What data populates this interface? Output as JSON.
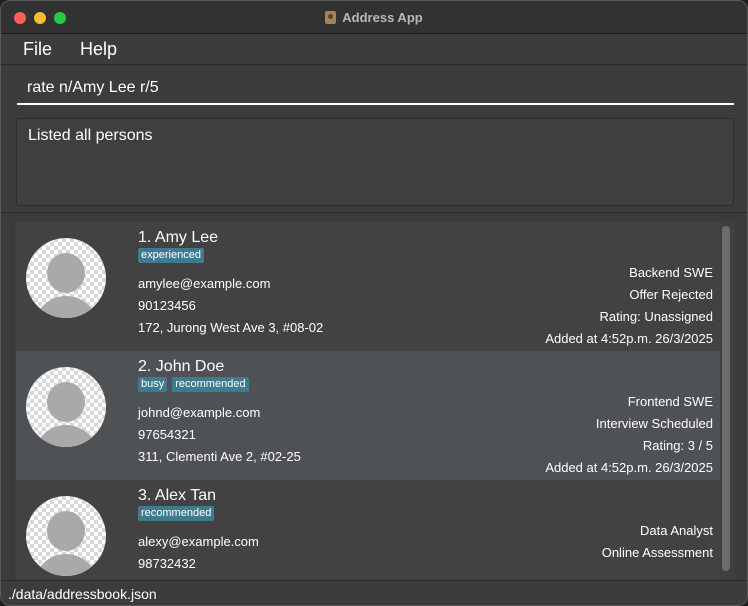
{
  "window": {
    "title": "Address App"
  },
  "menu": {
    "items": [
      "File",
      "Help"
    ]
  },
  "command": {
    "value": "rate n/Amy Lee r/5"
  },
  "result": {
    "text": "Listed all persons"
  },
  "persons": [
    {
      "name": "1. Amy Lee",
      "tags": [
        "experienced"
      ],
      "email": "amylee@example.com",
      "phone": "90123456",
      "address": "172, Jurong West Ave 3, #08-02",
      "role": "Backend SWE",
      "status": "Offer Rejected",
      "rating": "Rating: Unassigned",
      "added": "Added at 4:52p.m. 26/3/2025"
    },
    {
      "name": "2. John Doe",
      "tags": [
        "busy",
        "recommended"
      ],
      "email": "johnd@example.com",
      "phone": "97654321",
      "address": "311, Clementi Ave 2, #02-25",
      "role": "Frontend SWE",
      "status": "Interview Scheduled",
      "rating": "Rating: 3 / 5",
      "added": "Added at 4:52p.m. 26/3/2025"
    },
    {
      "name": "3. Alex Tan",
      "tags": [
        "recommended"
      ],
      "email": "alexy@example.com",
      "phone": "98732432",
      "address": "",
      "role": "Data Analyst",
      "status": "Online Assessment",
      "rating": "",
      "added": ""
    }
  ],
  "status_bar": {
    "path": "./data/addressbook.json"
  },
  "colors": {
    "tag": "#3e7b91",
    "selected_row": "#4e5254",
    "close": "#fe5f57",
    "minimize": "#febc2e",
    "maximize": "#28c840"
  },
  "icons": [
    "close-icon",
    "minimize-icon",
    "maximize-icon",
    "app-icon",
    "avatar-icon"
  ]
}
